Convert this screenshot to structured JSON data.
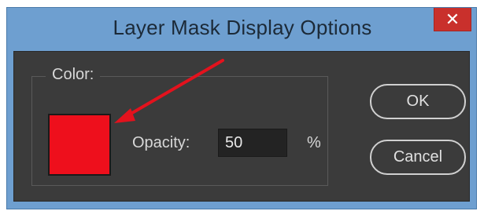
{
  "window": {
    "title": "Layer Mask Display Options",
    "close_glyph": "✕"
  },
  "group": {
    "label": "Color:"
  },
  "swatch": {
    "color": "#ee0f1c"
  },
  "opacity": {
    "label": "Opacity:",
    "value": "50",
    "unit": "%"
  },
  "buttons": {
    "ok_label": "OK",
    "cancel_label": "Cancel"
  },
  "annotation": {
    "arrow_color": "#e3121d"
  },
  "colors": {
    "title_bar": "#6e9fd0",
    "dialog_bg": "#3b3b3b",
    "close_bg": "#c9302c"
  }
}
